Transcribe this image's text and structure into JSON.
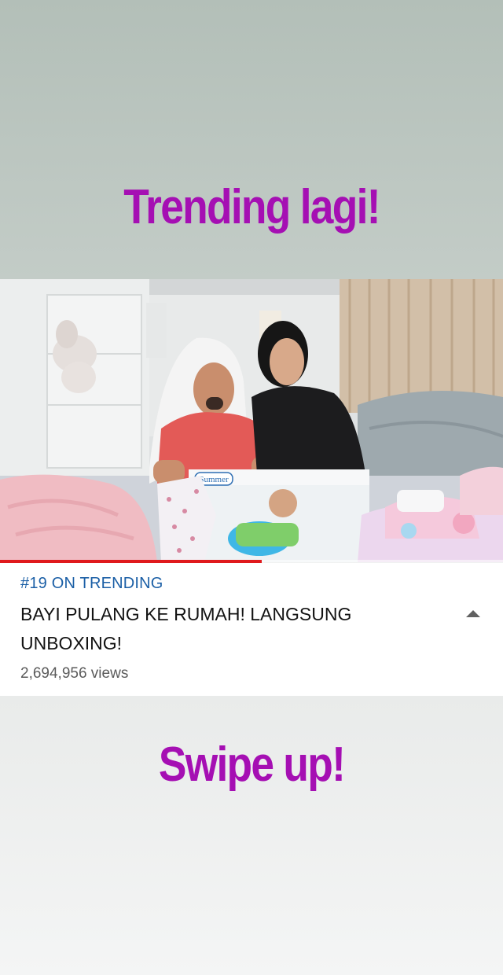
{
  "story": {
    "top_caption": "Trending lagi!",
    "bottom_caption": "Swipe up!",
    "caption_color": "#a50fb3"
  },
  "video": {
    "thumbnail_description_icon": "video-thumbnail-image",
    "box_brand": "Summer",
    "progress_fraction": 0.52,
    "progress_color": "#e0191d",
    "trending_label": "#19 ON TRENDING",
    "title": "BAYI PULANG KE RUMAH! LANGSUNG UNBOXING!",
    "views": "2,694,956 views",
    "collapse_icon": "caret-up-icon"
  }
}
